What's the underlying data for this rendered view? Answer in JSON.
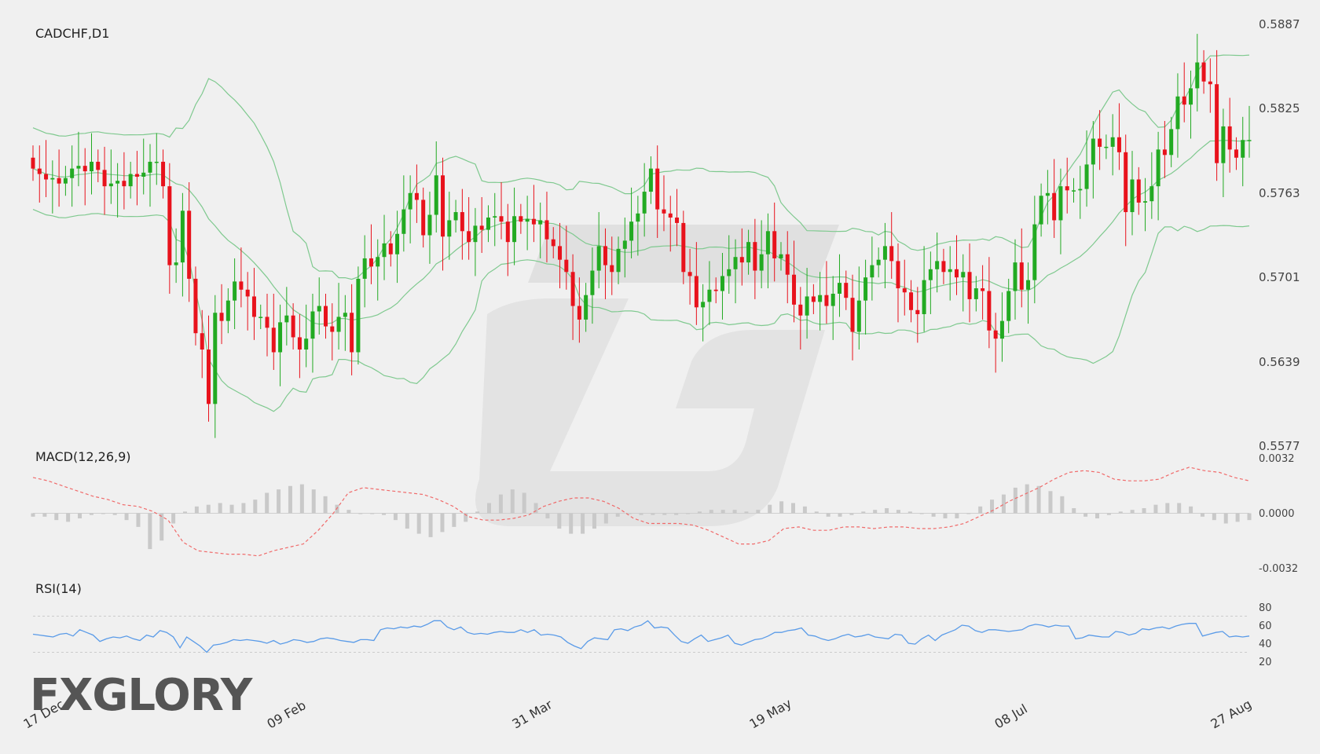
{
  "panels": {
    "price": {
      "title": "CADCHF,D1",
      "yticks": [
        "0.5887",
        "0.5825",
        "0.5763",
        "0.5701",
        "0.5639",
        "0.5577"
      ]
    },
    "macd": {
      "title": "MACD(12,26,9)",
      "yticks": [
        "0.0032",
        "0.0000",
        "-0.0032"
      ]
    },
    "rsi": {
      "title": "RSI(14)",
      "yticks": [
        "80",
        "60",
        "40",
        "20"
      ]
    }
  },
  "xticks": [
    "17 Dec",
    "09 Feb",
    "31 Mar",
    "19 May",
    "08 Jul",
    "27 Aug"
  ],
  "logo": {
    "text": "FXGLORY",
    "icon": "fxglory-logo-icon"
  },
  "colors": {
    "bull": "#22aa22",
    "bear": "#e8121c",
    "bands": "#7fc98f",
    "macd_signal": "#f06a6a",
    "macd_hist": "#c9c9c9",
    "rsi": "#5a9be8",
    "grid_dash": "#cccccc",
    "text": "#222222",
    "axis_text": "#444444"
  },
  "chart_data": [
    {
      "type": "candlestick",
      "title": "CADCHF,D1",
      "x": [
        "17 Dec",
        "09 Feb",
        "31 Mar",
        "19 May",
        "08 Jul",
        "27 Aug"
      ],
      "ylim": [
        0.5577,
        0.5887
      ],
      "indicator": "Bollinger Bands",
      "close_series": [
        0.5781,
        0.5777,
        0.5773,
        0.5774,
        0.577,
        0.5774,
        0.5781,
        0.5783,
        0.5779,
        0.5786,
        0.578,
        0.5768,
        0.577,
        0.5772,
        0.5768,
        0.5777,
        0.5775,
        0.5778,
        0.5786,
        0.5786,
        0.5768,
        0.571,
        0.5712,
        0.575,
        0.57,
        0.566,
        0.5648,
        0.5608,
        0.5675,
        0.5669,
        0.5684,
        0.5698,
        0.5692,
        0.5687,
        0.5672,
        0.5672,
        0.5664,
        0.5646,
        0.5668,
        0.5673,
        0.5657,
        0.5648,
        0.5656,
        0.5676,
        0.568,
        0.5665,
        0.5661,
        0.5672,
        0.5675,
        0.5646,
        0.57,
        0.5715,
        0.5709,
        0.5716,
        0.5726,
        0.5718,
        0.5733,
        0.5751,
        0.5763,
        0.5758,
        0.5732,
        0.5747,
        0.5776,
        0.5731,
        0.5743,
        0.5749,
        0.5735,
        0.5727,
        0.5739,
        0.5736,
        0.5745,
        0.5746,
        0.5742,
        0.5727,
        0.5746,
        0.5742,
        0.5744,
        0.574,
        0.5743,
        0.5729,
        0.5724,
        0.5714,
        0.5705,
        0.568,
        0.567,
        0.5688,
        0.5706,
        0.5724,
        0.571,
        0.5705,
        0.5722,
        0.5728,
        0.5742,
        0.5748,
        0.5764,
        0.5781,
        0.5751,
        0.5748,
        0.5745,
        0.5741,
        0.5705,
        0.5702,
        0.5679,
        0.5683,
        0.5692,
        0.5691,
        0.5702,
        0.5707,
        0.5716,
        0.5712,
        0.5727,
        0.5706,
        0.5718,
        0.5735,
        0.5715,
        0.5718,
        0.5703,
        0.5681,
        0.5673,
        0.5687,
        0.5683,
        0.5688,
        0.568,
        0.5689,
        0.5697,
        0.5686,
        0.5661,
        0.5684,
        0.5701,
        0.571,
        0.5714,
        0.5724,
        0.5713,
        0.5693,
        0.569,
        0.5677,
        0.5674,
        0.5699,
        0.5707,
        0.5713,
        0.5705,
        0.5707,
        0.5701,
        0.5705,
        0.5685,
        0.5693,
        0.5691,
        0.5662,
        0.5656,
        0.5669,
        0.5691,
        0.5712,
        0.5692,
        0.5699,
        0.574,
        0.5761,
        0.5763,
        0.5743,
        0.5768,
        0.5765,
        0.5765,
        0.5766,
        0.5784,
        0.5803,
        0.5797,
        0.5797,
        0.5804,
        0.5793,
        0.5749,
        0.5773,
        0.5756,
        0.5757,
        0.5768,
        0.5795,
        0.5791,
        0.581,
        0.5834,
        0.5828,
        0.584,
        0.5859,
        0.5845,
        0.5843,
        0.5785,
        0.5812,
        0.5795,
        0.5789,
        0.5802,
        0.5802
      ]
    },
    {
      "type": "line",
      "title": "MACD(12,26,9)",
      "ylim": [
        -0.0032,
        0.0032
      ],
      "series": [
        {
          "values": [
            -0.0002,
            -0.0002,
            -0.0004,
            -0.0005,
            -0.0003,
            -0.0001,
            0.0,
            -0.0001,
            -0.0004,
            -0.0008,
            -0.0021,
            -0.0016,
            -0.0006,
            0.0001,
            0.0004,
            0.0005,
            0.0006,
            0.0005,
            0.0006,
            0.0008,
            0.0012,
            0.0014,
            0.0016,
            0.0017,
            0.0014,
            0.001,
            0.0005,
            0.0002,
            0.0,
            0.0,
            -0.0001,
            -0.0004,
            -0.0009,
            -0.0012,
            -0.0014,
            -0.0011,
            -0.0008,
            -0.0005,
            0.0001,
            0.0006,
            0.0011,
            0.0014,
            0.0012,
            0.0006,
            -0.0003,
            -0.0009,
            -0.0012,
            -0.0012,
            -0.0009,
            -0.0006,
            -0.0002,
            0.0,
            -0.0001,
            -0.0001,
            -0.0001,
            -0.0001,
            0.0,
            0.0001,
            0.0002,
            0.0002,
            0.0002,
            0.0001,
            0.0002,
            0.0005,
            0.0007,
            0.0006,
            0.0004,
            0.0001,
            -0.0002,
            -0.0002,
            -0.0001,
            0.0001,
            0.0002,
            0.0003,
            0.0002,
            0.0001,
            0.0,
            -0.0002,
            -0.0003,
            -0.0003,
            0.0,
            0.0004,
            0.0008,
            0.0011,
            0.0015,
            0.0017,
            0.0016,
            0.0013,
            0.001,
            0.0003,
            -0.0002,
            -0.0003,
            -0.0001,
            0.0001,
            0.0002,
            0.0003,
            0.0005,
            0.0006,
            0.0006,
            0.0004,
            -0.0002,
            -0.0004,
            -0.0006,
            -0.0005,
            -0.0004
          ]
        },
        {
          "values": [
            0.0021,
            0.0019,
            0.0016,
            0.0013,
            0.001,
            0.0008,
            0.0005,
            0.0004,
            0.0001,
            -0.0004,
            -0.0017,
            -0.0022,
            -0.0023,
            -0.0024,
            -0.0024,
            -0.0025,
            -0.0022,
            -0.002,
            -0.0018,
            -0.001,
            0.0,
            0.0012,
            0.0015,
            0.0014,
            0.0013,
            0.0012,
            0.0011,
            0.0008,
            0.0004,
            -0.0002,
            -0.0004,
            -0.0004,
            -0.0003,
            -0.0001,
            0.0004,
            0.0007,
            0.0009,
            0.0009,
            0.0007,
            0.0003,
            -0.0003,
            -0.0006,
            -0.0006,
            -0.0006,
            -0.0007,
            -0.001,
            -0.0014,
            -0.0018,
            -0.0018,
            -0.0016,
            -0.0009,
            -0.0008,
            -0.001,
            -0.001,
            -0.0008,
            -0.0008,
            -0.0009,
            -0.0008,
            -0.0008,
            -0.0009,
            -0.0009,
            -0.0008,
            -0.0006,
            -0.0002,
            0.0002,
            0.0007,
            0.0011,
            0.0015,
            0.002,
            0.0024,
            0.0025,
            0.0024,
            0.002,
            0.0019,
            0.0019,
            0.002,
            0.0024,
            0.0027,
            0.0025,
            0.0024,
            0.0021,
            0.0019
          ]
        }
      ]
    },
    {
      "type": "line",
      "title": "RSI(14)",
      "ylim": [
        20,
        80
      ],
      "series": [
        {
          "values": [
            50,
            49,
            48,
            47,
            50,
            51,
            48,
            55,
            52,
            49,
            42,
            45,
            47,
            46,
            48,
            45,
            43,
            49,
            47,
            54,
            52,
            47,
            35,
            47,
            42,
            37,
            30,
            38,
            39,
            41,
            44,
            43,
            44,
            43,
            42,
            40,
            43,
            39,
            41,
            44,
            43,
            41,
            42,
            45,
            46,
            45,
            43,
            42,
            41,
            44,
            44,
            43,
            55,
            57,
            56,
            58,
            57,
            59,
            58,
            61,
            65,
            65,
            58,
            55,
            58,
            52,
            50,
            51,
            50,
            52,
            53,
            52,
            52,
            55,
            52,
            55,
            49,
            50,
            49,
            47,
            41,
            37,
            34,
            42,
            46,
            45,
            44,
            55,
            56,
            54,
            58,
            60,
            65,
            57,
            58,
            57,
            49,
            42,
            40,
            45,
            49,
            42,
            44,
            46,
            49,
            40,
            38,
            41,
            44,
            45,
            48,
            52,
            52,
            54,
            55,
            57,
            49,
            48,
            45,
            43,
            45,
            48,
            50,
            47,
            48,
            50,
            47,
            46,
            45,
            50,
            49,
            40,
            39,
            45,
            49,
            43,
            49,
            52,
            55,
            60,
            59,
            54,
            52,
            55,
            55,
            54,
            53,
            54,
            55,
            59,
            61,
            60,
            58,
            60,
            59,
            59,
            45,
            46,
            49,
            48,
            47,
            47,
            53,
            52,
            49,
            51,
            56,
            55,
            57,
            58,
            56,
            59,
            61,
            62,
            62,
            48,
            50,
            52,
            53,
            47,
            48,
            47,
            48
          ]
        }
      ]
    }
  ]
}
